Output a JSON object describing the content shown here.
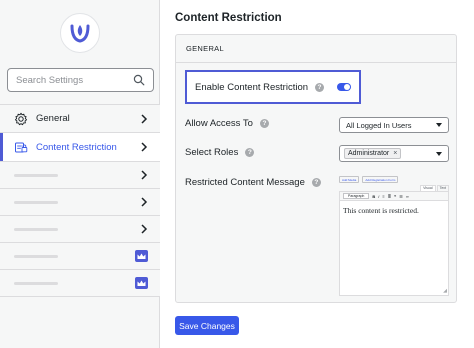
{
  "sidebar": {
    "search_placeholder": "Search Settings",
    "items": [
      {
        "label": "General",
        "icon": "gear-icon"
      },
      {
        "label": "Content Restriction",
        "icon": "content-restriction-icon"
      }
    ],
    "locked_placeholder_count": 5,
    "accent_color": "#4f5bd5"
  },
  "main": {
    "title": "Content Restriction",
    "section_heading": "GENERAL",
    "enable_label": "Enable Content Restriction",
    "enable_value": true,
    "allow_access_label": "Allow Access To",
    "allow_access_value": "All Logged In Users",
    "select_roles_label": "Select Roles",
    "selected_roles": [
      "Administrator"
    ],
    "message_label": "Restricted Content Message",
    "editor": {
      "add_media": "Add Media",
      "add_form": "Add Registration Form",
      "tab_visual": "Visual",
      "tab_text": "Text",
      "format": "Paragraph",
      "content": "This content is restricted."
    },
    "save_label": "Save Changes",
    "primary_color": "#3858e9"
  }
}
